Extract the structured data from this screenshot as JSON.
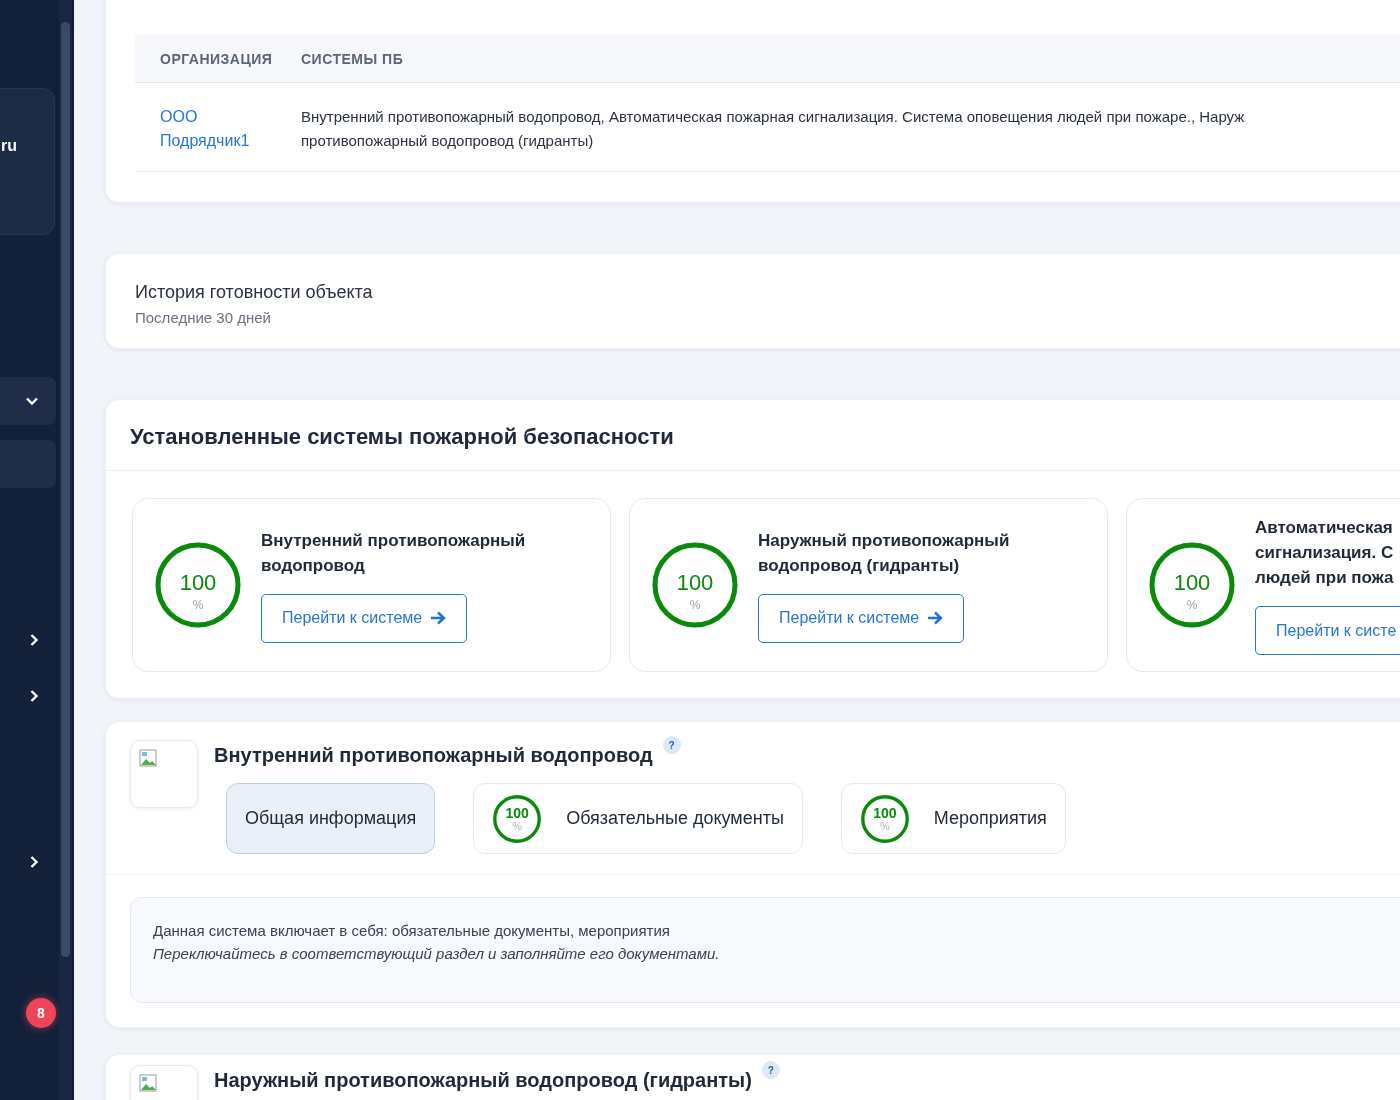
{
  "sidebar": {
    "brand_text": "ru",
    "items": [
      {
        "kind": "dropdown"
      },
      {
        "kind": "plain"
      },
      {
        "kind": "submenu"
      },
      {
        "kind": "submenu"
      },
      {
        "kind": "submenu"
      }
    ],
    "badge": "8"
  },
  "contractors": {
    "columns": [
      "ОРГАНИЗАЦИЯ",
      "СИСТЕМЫ ПБ"
    ],
    "rows": [
      {
        "organization": "ООО Подрядчик1",
        "systems": [
          "Внутренний противопожарный водопровод, Автоматическая пожарная сигнализация. Система оповещения людей при пожаре., Наруж",
          "противопожарный водопровод (гидранты)"
        ]
      }
    ]
  },
  "history": {
    "title": "История готовности объекта",
    "subtitle": "Последние 30 дней"
  },
  "systems": {
    "title": "Установленные системы пожарной безопасности",
    "cards": [
      {
        "title": [
          "Внутренний противопожарный",
          "водопровод"
        ],
        "value": "100",
        "unit": "%",
        "level": 1,
        "button": "Перейти к системе"
      },
      {
        "title": [
          "Наружный противопожарный",
          "водопровод (гидранты)"
        ],
        "value": "100",
        "unit": "%",
        "level": 1,
        "button": "Перейти к системе"
      },
      {
        "title": [
          "Автоматическая",
          "сигнализация. С",
          "людей при пожа"
        ],
        "value": "100",
        "unit": "%",
        "level": 1,
        "button": "Перейти к систе"
      }
    ]
  },
  "details": [
    {
      "title": "Внутренний противопожарный водопровод",
      "help": "?",
      "tabs": [
        {
          "label": "Общая информация",
          "selected": true
        },
        {
          "progress": {
            "value": "100",
            "unit": "%",
            "level": 1
          },
          "label": "Обязательные документы",
          "selected": false
        },
        {
          "progress": {
            "value": "100",
            "unit": "%",
            "level": 1
          },
          "label": "Мероприятия",
          "selected": false
        }
      ],
      "info": {
        "text": "Данная система включает в себя: обязательные документы, мероприятия",
        "hint": "Переключайтесь в соответствующий раздел и заполняйте его документами."
      }
    },
    {
      "title": "Наружный противопожарный водопровод (гидранты)",
      "help": "?"
    }
  ]
}
